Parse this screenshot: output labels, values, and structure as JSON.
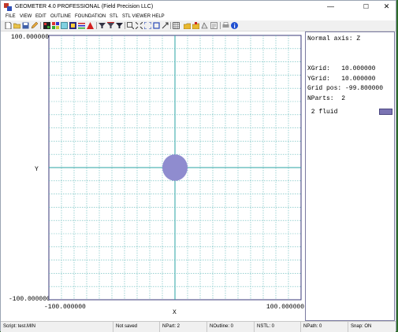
{
  "window": {
    "title": "GEOMETER 4.0 PROFESSIONAL (Field Precision LLC)",
    "minimize": "—",
    "maximize": "☐",
    "close": "✕"
  },
  "menu": [
    "FILE",
    "VIEW",
    "EDIT",
    "OUTLINE",
    "FOUNDATION",
    "STL",
    "STL VIEWER",
    "HELP"
  ],
  "toolbar_icons": [
    "new-file-icon",
    "open-folder-icon",
    "save-icon",
    "edit-pencil-icon",
    "parts-icon",
    "color-grid-icon",
    "fill-icon",
    "region-icon",
    "list-icon",
    "triangle-icon",
    "filter-icon",
    "filter-alt-icon",
    "filter-3-icon",
    "zoom-window-icon",
    "zoom-fit-icon",
    "zoom-in-icon",
    "zoom-all-icon",
    "arrow-icon",
    "grid-icon",
    "folder-export-icon",
    "folder-import-icon",
    "stl-icon",
    "properties-icon",
    "info-icon"
  ],
  "plot": {
    "y_max": "100.000000",
    "y_min": "-100.000000",
    "x_min": "-100.000000",
    "x_max": "100.000000",
    "x_axis_label": "X",
    "y_axis_label": "Y",
    "grid_color": "#5fb8b8",
    "axis_color": "#2aa3a3",
    "part_color": "#8f8ccf",
    "part": {
      "label": "fluid",
      "center_x": 0,
      "center_y": 0,
      "radius": 10
    }
  },
  "side_panel": {
    "normal_axis": "Normal axis: Z",
    "xgrid": "XGrid:   10.000000",
    "ygrid": "YGrid:   10.000000",
    "grid_pos": "Grid pos: -99.800000",
    "nparts": "NParts:  2",
    "part_entry": " 2 fluid",
    "swatch_color": "#7b74b3"
  },
  "status": {
    "script": "Script: test.MIN",
    "saved": "Not saved",
    "npart": "NPart:  2",
    "noutline": "NOutline:  0",
    "nstl": "NSTL:  0",
    "npath": "NPath:  0",
    "snap": "Snap: ON"
  }
}
